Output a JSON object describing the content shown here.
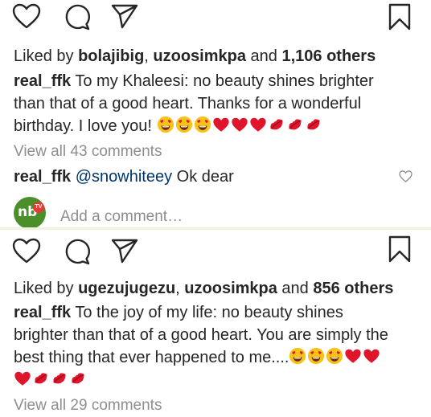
{
  "post1": {
    "liked_prefix": "Liked by ",
    "liked_user1": "bolajibig",
    "liked_sep": ", ",
    "liked_user2": "uzoosimkpa",
    "liked_and": " and ",
    "liked_count": "1,106 others",
    "author": "real_ffk",
    "caption_line1": " To my Khaleesi: no beauty shines brighter",
    "caption_line2": "than that of a good heart. Thanks for a wonderful",
    "caption_line3": "birthday. I love you! ",
    "caption_emojis": [
      "heart-eyes",
      "heart-eyes",
      "heart-eyes",
      "red-heart",
      "red-heart",
      "red-heart",
      "kiss-lips",
      "kiss-lips",
      "kiss-lips"
    ],
    "view_comments": "View all 43 comments",
    "comment_author": "real_ffk",
    "comment_mention": "@snowhiteey",
    "comment_text": " Ok dear",
    "add_comment_placeholder": "Add a comment…",
    "avatar_text": "nb",
    "avatar_badge": "TV"
  },
  "post2": {
    "liked_prefix": "Liked by ",
    "liked_user1": "ugezujugezu",
    "liked_sep": ", ",
    "liked_user2": "uzoosimkpa",
    "liked_and": " and ",
    "liked_count": "856 others",
    "author": "real_ffk",
    "caption_line1": " To the joy of my life: no beauty shines",
    "caption_line2": "brighter than that of a good heart. You are simply the",
    "caption_line3": "best thing that ever happened to me....",
    "caption_emojis_line3": [
      "heart-eyes",
      "heart-eyes",
      "heart-eyes",
      "red-heart",
      "red-heart"
    ],
    "caption_emojis_line4": [
      "red-heart",
      "kiss-lips",
      "kiss-lips",
      "kiss-lips"
    ],
    "view_comments": "View all 29 comments"
  },
  "colors": {
    "text": "#262626",
    "muted": "#8e8e8e",
    "mention": "#003569",
    "heart_red": "#e0142a",
    "emoji_yellow": "#f7c21a"
  }
}
